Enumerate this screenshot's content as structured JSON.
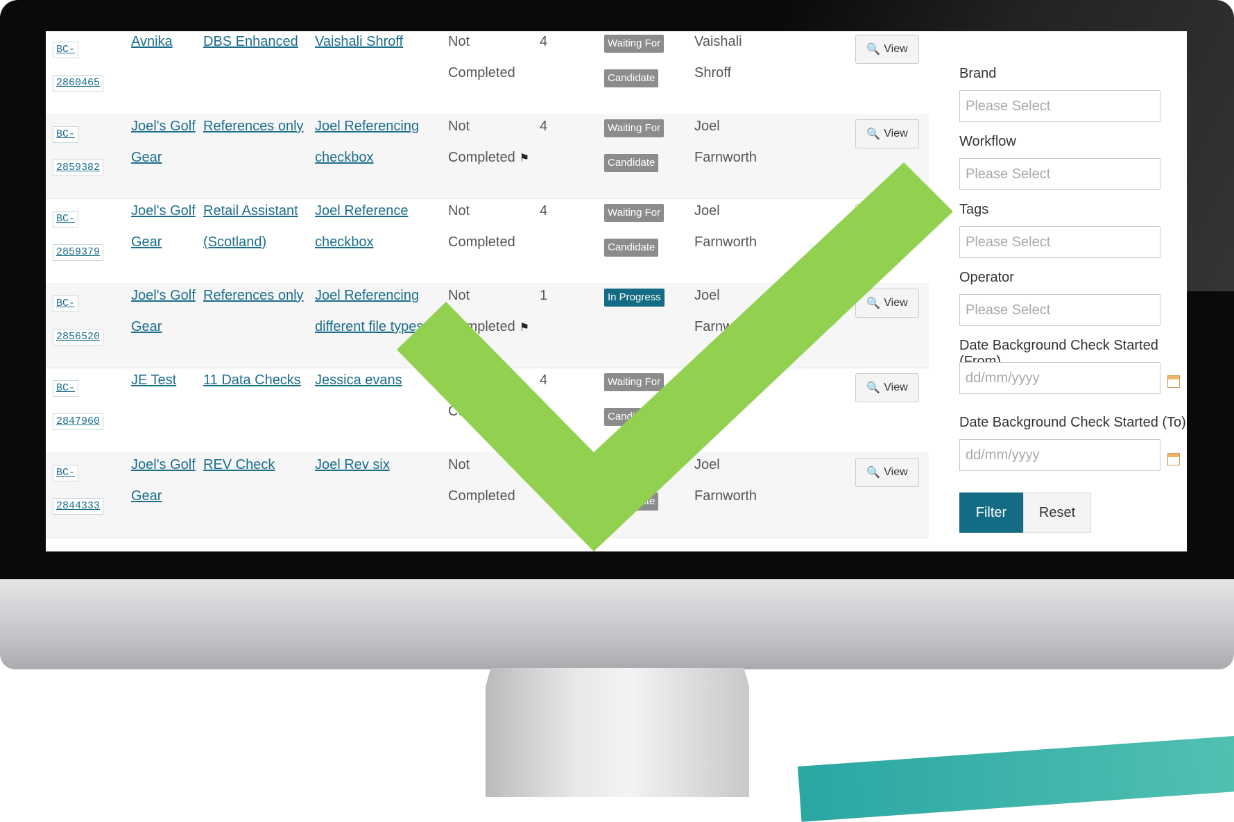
{
  "rows": [
    {
      "ref_prefix": "BC-",
      "ref_num": "2860465",
      "brand_1": "Avnika",
      "brand_2": "",
      "workflow_1": "DBS Enhanced",
      "workflow_2": "",
      "candidate_1": "Vaishali Shroff",
      "candidate_2": "",
      "status_1": "Not",
      "status_2": "Completed",
      "flag": false,
      "count": "4",
      "badge_1": "Waiting For",
      "badge_2": "Candidate",
      "operator_1": "Vaishali",
      "operator_2": "Shroff",
      "view": "View"
    },
    {
      "ref_prefix": "BC-",
      "ref_num": "2859382",
      "brand_1": "Joel's Golf",
      "brand_2": "Gear",
      "workflow_1": "References only",
      "workflow_2": "",
      "candidate_1": "Joel Referencing",
      "candidate_2": "checkbox",
      "status_1": "Not",
      "status_2": "Completed",
      "flag": true,
      "count": "4",
      "badge_1": "Waiting For",
      "badge_2": "Candidate",
      "operator_1": "Joel",
      "operator_2": "Farnworth",
      "view": "View"
    },
    {
      "ref_prefix": "BC-",
      "ref_num": "2859379",
      "brand_1": "Joel's Golf",
      "brand_2": "Gear",
      "workflow_1": "Retail Assistant",
      "workflow_2": "(Scotland)",
      "candidate_1": "Joel Reference",
      "candidate_2": "checkbox",
      "status_1": "Not",
      "status_2": "Completed",
      "flag": false,
      "count": "4",
      "badge_1": "Waiting For",
      "badge_2": "Candidate",
      "operator_1": "Joel",
      "operator_2": "Farnworth",
      "view": "View"
    },
    {
      "ref_prefix": "BC-",
      "ref_num": "2856520",
      "brand_1": "Joel's Golf",
      "brand_2": "Gear",
      "workflow_1": "References only",
      "workflow_2": "",
      "candidate_1": "Joel Referencing",
      "candidate_2": "different file types",
      "status_1": "Not",
      "status_2": "Completed",
      "flag": true,
      "count": "1",
      "badge_1": "In Progress",
      "badge_2": "",
      "operator_1": "Joel",
      "operator_2": "Farnworth",
      "view": "View"
    },
    {
      "ref_prefix": "BC-",
      "ref_num": "2847960",
      "brand_1": "JE Test",
      "brand_2": "",
      "workflow_1": "11 Data Checks",
      "workflow_2": "",
      "candidate_1": "Jessica evans",
      "candidate_2": "",
      "status_1": "Not",
      "status_2": "Completed",
      "flag": false,
      "count": "4",
      "badge_1": "Waiting For",
      "badge_2": "Candidate",
      "operator_1": "",
      "operator_2": "",
      "view": "View"
    },
    {
      "ref_prefix": "BC-",
      "ref_num": "2844333",
      "brand_1": "Joel's Golf",
      "brand_2": "Gear",
      "workflow_1": "REV Check",
      "workflow_2": "",
      "candidate_1": "Joel Rev six",
      "candidate_2": "",
      "status_1": "Not",
      "status_2": "Completed",
      "flag": false,
      "count": "",
      "badge_1": "",
      "badge_2": "Candidate",
      "operator_1": "Joel",
      "operator_2": "Farnworth",
      "view": "View"
    }
  ],
  "filters": {
    "brand_label": "Brand",
    "brand_placeholder": "Please Select",
    "workflow_label": "Workflow",
    "workflow_placeholder": "Please Select",
    "tags_label": "Tags",
    "tags_placeholder": "Please Select",
    "operator_label": "Operator",
    "operator_placeholder": "Please Select",
    "date_from_label": "Date Background Check Started (From)",
    "date_from_placeholder": "dd/mm/yyyy",
    "date_to_label": "Date Background Check Started (To)",
    "date_to_placeholder": "dd/mm/yyyy",
    "filter_button": "Filter",
    "reset_button": "Reset"
  },
  "colors": {
    "accent": "#136b84",
    "link": "#1b6e8c",
    "badge_waiting": "#8c8c8c",
    "checkmark": "#92d050",
    "swoosh": "#2aa6a3"
  },
  "icons": {
    "view": "magnifier-icon",
    "flag": "flag-icon",
    "calendar": "calendar-icon",
    "overlay": "checkmark-icon"
  }
}
